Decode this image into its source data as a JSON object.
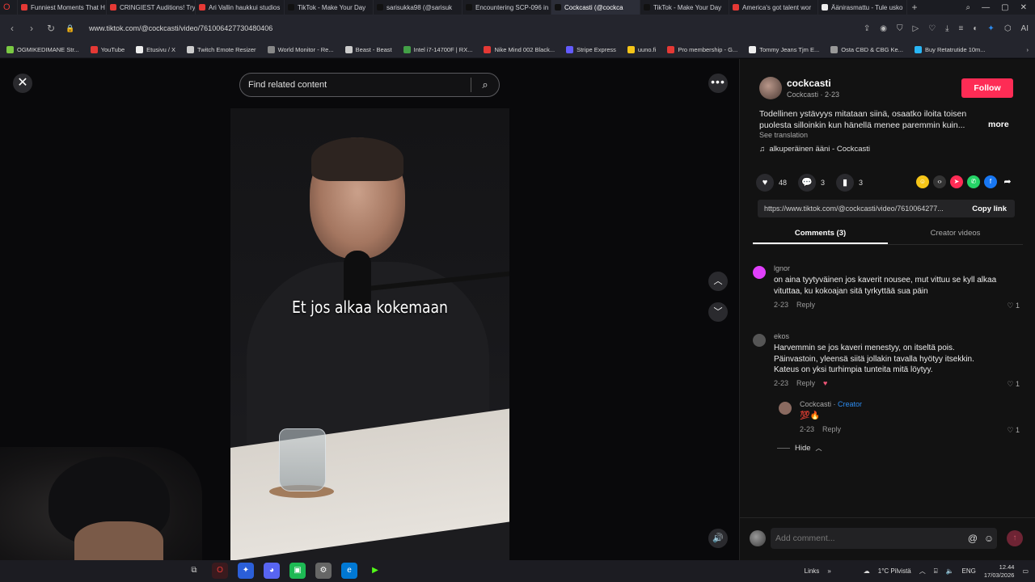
{
  "browser": {
    "tabs": [
      {
        "title": "Funniest Moments That H",
        "color": "#e53935",
        "active": false
      },
      {
        "title": "CRINGIEST Auditions! Try",
        "color": "#e53935",
        "active": false
      },
      {
        "title": "Ari Vallin haukkui studios",
        "color": "#e53935",
        "active": false
      },
      {
        "title": "TikTok - Make Your Day",
        "color": "#111111",
        "active": false
      },
      {
        "title": "sarisukka98 (@sarisuk",
        "color": "#111111",
        "active": false
      },
      {
        "title": "Encountering SCP-096 in",
        "color": "#111111",
        "active": false
      },
      {
        "title": "Cockcasti (@cockca",
        "color": "#111111",
        "active": true
      },
      {
        "title": "TikTok - Make Your Day",
        "color": "#111111",
        "active": false
      },
      {
        "title": "America's got talent wor",
        "color": "#e53935",
        "active": false
      },
      {
        "title": "Äänirasmattu - Tule usko",
        "color": "#eeeeee",
        "active": false
      }
    ],
    "url": "www.tiktok.com/@cockcasti/video/7610064277304804​06",
    "bookmarks": [
      {
        "label": "OGMIKEDIMANE Str...",
        "color": "#7ac943"
      },
      {
        "label": "YouTube",
        "color": "#e53935"
      },
      {
        "label": "Etusivu / X",
        "color": "#eeeeee"
      },
      {
        "label": "Twitch Emote Resizer",
        "color": "#cccccc"
      },
      {
        "label": "World Monitor - Re...",
        "color": "#888888"
      },
      {
        "label": "Beast - Beast",
        "color": "#cccccc"
      },
      {
        "label": "Intel i7-14700F | RX...",
        "color": "#43a047"
      },
      {
        "label": "Nike Mind 002 Black...",
        "color": "#e53935"
      },
      {
        "label": "Stripe Express",
        "color": "#635bff"
      },
      {
        "label": "uuno.fi",
        "color": "#f5c518"
      },
      {
        "label": "Pro membership - G...",
        "color": "#e53935"
      },
      {
        "label": "Tommy Jeans Tjm E...",
        "color": "#eeeeee"
      },
      {
        "label": "Osta CBD & CBG Ke...",
        "color": "#999999"
      },
      {
        "label": "Buy Retatrutide 10m...",
        "color": "#29b6f6"
      }
    ]
  },
  "player": {
    "search_placeholder": "Find related content",
    "subtitle": "Et jos alkaa kokemaan"
  },
  "post": {
    "username": "cockcasti",
    "display": "Cockcasti · 2-23",
    "follow_label": "Follow",
    "description": "Todellinen ystävyys mitataan siinä, osaatko iloita toisen puolesta silloinkin kun hänellä menee paremmin kuin...",
    "more_label": "more",
    "see_translation": "See translation",
    "sound": "alkuperäinen ääni - Cockcasti",
    "likes": "48",
    "comments_count": "3",
    "saves": "3",
    "share_url": "https://www.tiktok.com/@cockcasti/video/7610064277...",
    "copy_link_label": "Copy link",
    "tab_comments": "Comments (3)",
    "tab_creator": "Creator videos"
  },
  "comments": [
    {
      "name": "lgnor",
      "text": "on aina tyytyväinen jos kaverit nousee, mut vittuu se kyll alkaa vituttaa, ku kokoajan sitä tyrkyttää sua päin",
      "date": "2-23",
      "reply": "Reply",
      "likes": "1"
    },
    {
      "name": "ekos",
      "text": "Harvemmin se jos kaveri menestyy, on itseltä pois. Päinvastoin, yleensä siitä jollakin tavalla hyötyy itsekkin. Kateus on yksi turhimpia tunteita mitä löytyy.",
      "date": "2-23",
      "reply": "Reply",
      "likes": "1"
    },
    {
      "name": "Cockcasti",
      "badge": "Creator",
      "text": "💯🔥",
      "date": "2-23",
      "reply": "Reply",
      "likes": "1"
    }
  ],
  "hide_label": "Hide",
  "add_comment_placeholder": "Add comment...",
  "taskbar": {
    "links_label": "Links",
    "weather": "1°C  Pilvistä",
    "lang": "ENG",
    "time": "12.44",
    "date": "17/03/2026"
  },
  "colors": {
    "accent": "#fe2c55",
    "creator": "#2d8cf0"
  }
}
